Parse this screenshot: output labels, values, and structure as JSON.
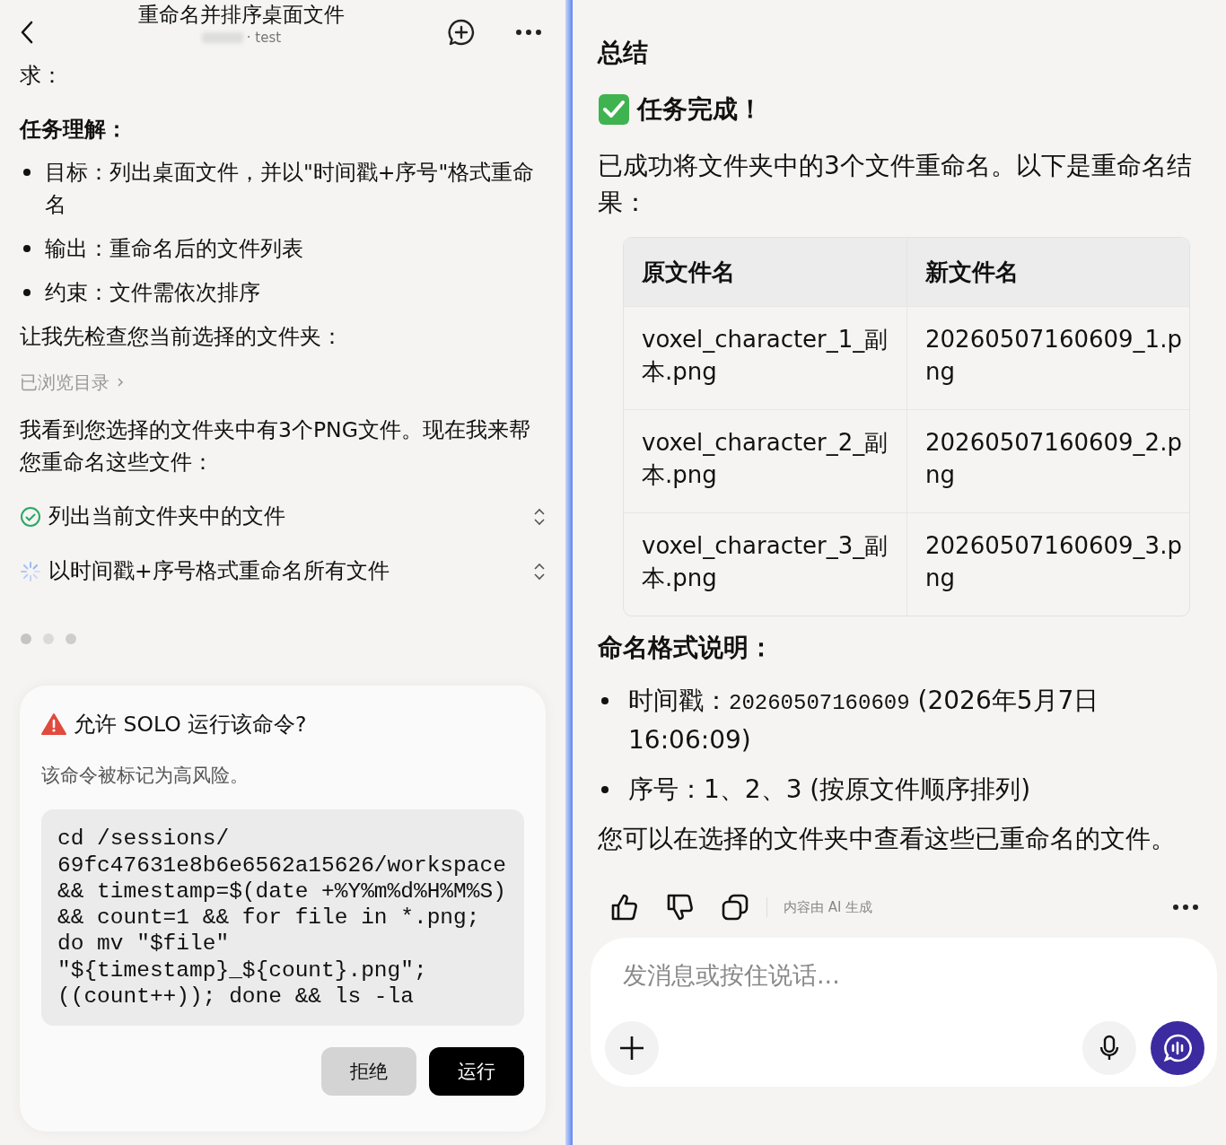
{
  "header": {
    "title": "重命名并排序桌面文件",
    "subtitle": "· test"
  },
  "left": {
    "partial_text": "求：",
    "section_title": "任务理解：",
    "bullets": [
      "目标：列出桌面文件，并以\"时间戳+序号\"格式重命名",
      "输出：重命名后的文件列表",
      "约束：文件需依次排序"
    ],
    "check_text": "让我先检查您当前选择的文件夹：",
    "browsed_link": "已浏览目录",
    "found_text": "我看到您选择的文件夹中有3个PNG文件。现在我来帮您重命名这些文件：",
    "steps": [
      {
        "label": "列出当前文件夹中的文件",
        "completed": true
      },
      {
        "label": "以时间戳+序号格式重命名所有文件",
        "completed": false
      }
    ],
    "permission_dialog": {
      "title": "允许 SOLO 运行该命令?",
      "description": "该命令被标记为高风险。",
      "command": "cd /sessions/ 69fc47631e8b6e6562a15626/workspace && timestamp=$(date +%Y%m%d%H%M%S) && count=1 && for file in *.png; do mv \"$file\" \"${timestamp}_${count}.png\"; ((count++)); done && ls -la",
      "buttons": [
        {
          "label": "拒绝",
          "kind": "secondary"
        },
        {
          "label": "运行",
          "kind": "primary"
        }
      ]
    }
  },
  "right": {
    "heading": "总结",
    "done_title": "任务完成！",
    "intro": "已成功将文件夹中的3个文件重命名。以下是重命名结果：",
    "table": {
      "columns": [
        "原文件名",
        "新文件名"
      ],
      "rows": [
        [
          "voxel_character_1_副本.png",
          "20260507160609_1.png"
        ],
        [
          "voxel_character_2_副本.png",
          "20260507160609_2.png"
        ],
        [
          "voxel_character_3_副本.png",
          "20260507160609_3.png"
        ]
      ]
    },
    "format_title": "命名格式说明：",
    "bullets": [
      [
        {
          "kind": "text",
          "text": "时间戳："
        },
        {
          "kind": "code",
          "text": "20260507160609"
        },
        {
          "kind": "text",
          "text": " (2026年5月7日 16:06:09)"
        }
      ],
      [
        {
          "kind": "text",
          "text": "序号：1、2、3 (按原文件顺序排列)"
        }
      ]
    ],
    "closing": "您可以在选择的文件夹中查看这些已重命名的文件。",
    "ai_note": "内容由 AI 生成",
    "composer": {
      "placeholder": "发消息或按住说话..."
    }
  }
}
